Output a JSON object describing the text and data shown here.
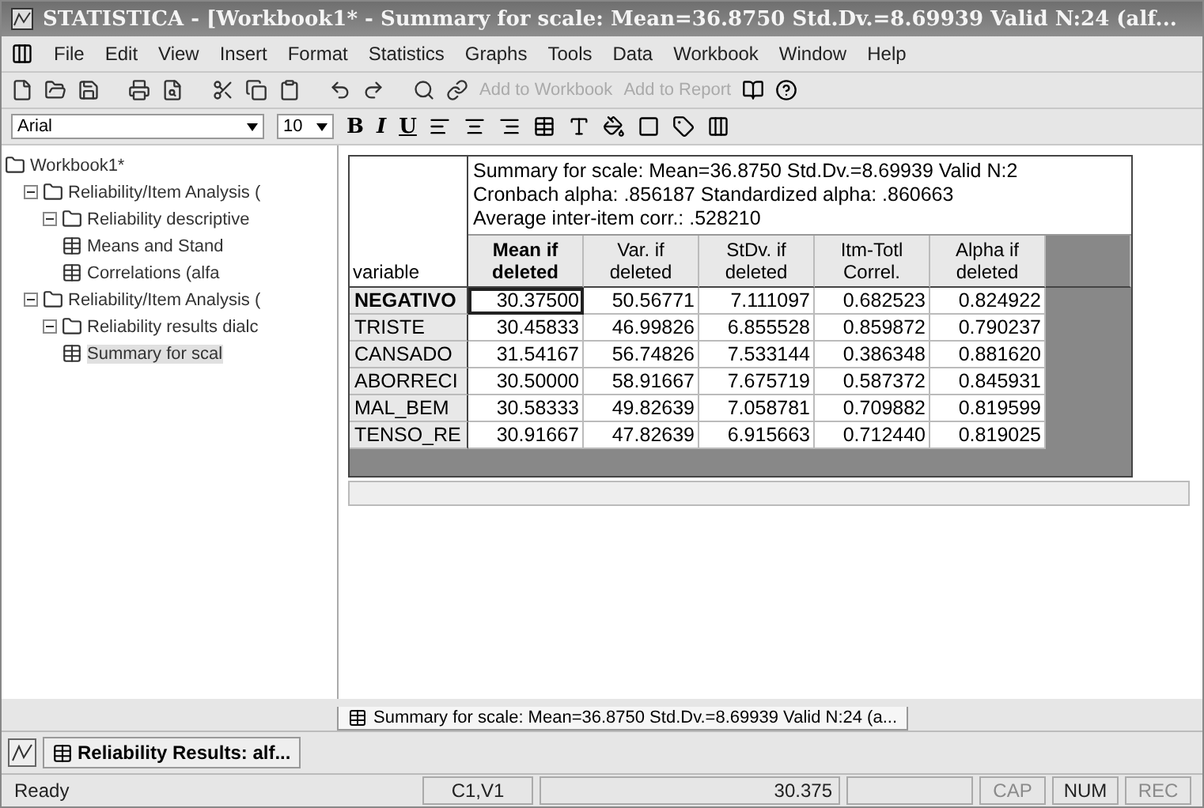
{
  "window": {
    "title": "STATISTICA - [Workbook1* - Summary for scale: Mean=36.8750 Std.Dv.=8.69939 Valid N:24 (alf..."
  },
  "menu": [
    "File",
    "Edit",
    "View",
    "Insert",
    "Format",
    "Statistics",
    "Graphs",
    "Tools",
    "Data",
    "Workbook",
    "Window",
    "Help"
  ],
  "toolbar": {
    "dropdowns": [
      {
        "label": "Add to Workbook",
        "disabled": true
      },
      {
        "label": "Add to Report",
        "disabled": true
      }
    ]
  },
  "format_bar": {
    "font": "Arial",
    "size": "10",
    "style_buttons": [
      "B",
      "I",
      "U"
    ]
  },
  "tree": {
    "label": "Workbook1*",
    "children": [
      {
        "label": "Reliability/Item Analysis (",
        "expanded": true,
        "children": [
          {
            "label": "Reliability descriptive",
            "expanded": true,
            "children": [
              {
                "label": "Means and Stand",
                "selected": false
              },
              {
                "label": "Correlations (alfa",
                "selected": false
              }
            ]
          }
        ]
      },
      {
        "label": "Reliability/Item Analysis (",
        "expanded": true,
        "children": [
          {
            "label": "Reliability results dialc",
            "expanded": true,
            "children": [
              {
                "label": "Summary for scal",
                "selected": true
              }
            ]
          }
        ]
      }
    ]
  },
  "sheet": {
    "corner": "variable",
    "info": [
      "Summary for scale: Mean=36.8750 Std.Dv.=8.69939 Valid N:2",
      "Cronbach alpha: .856187 Standardized alpha: .860663",
      "Average inter-item corr.: .528210"
    ],
    "columns": [
      {
        "label": "Mean if deleted",
        "selected": true
      },
      {
        "label": "Var. if deleted",
        "selected": false
      },
      {
        "label": "StDv. if deleted",
        "selected": false
      },
      {
        "label": "Itm-Totl Correl.",
        "selected": false
      },
      {
        "label": "Alpha if deleted",
        "selected": false
      }
    ],
    "rows": [
      {
        "name": "NEGATIVO",
        "selected": true,
        "values": [
          "30.37500",
          "50.56771",
          "7.111097",
          "0.682523",
          "0.824922"
        ]
      },
      {
        "name": "TRISTE",
        "selected": false,
        "values": [
          "30.45833",
          "46.99826",
          "6.855528",
          "0.859872",
          "0.790237"
        ]
      },
      {
        "name": "CANSADO",
        "selected": false,
        "values": [
          "31.54167",
          "56.74826",
          "7.533144",
          "0.386348",
          "0.881620"
        ]
      },
      {
        "name": "ABORRECI",
        "selected": false,
        "values": [
          "30.50000",
          "58.91667",
          "7.675719",
          "0.587372",
          "0.845931"
        ]
      },
      {
        "name": "MAL_BEM",
        "selected": false,
        "values": [
          "30.58333",
          "49.82639",
          "7.058781",
          "0.709882",
          "0.819599"
        ]
      },
      {
        "name": "TENSO_RE",
        "selected": false,
        "values": [
          "30.91667",
          "47.82639",
          "6.915663",
          "0.712440",
          "0.819025"
        ]
      }
    ]
  },
  "sheet_tab": "Summary for scale: Mean=36.8750 Std.Dv.=8.69939 Valid N:24 (a...",
  "taskbar": {
    "item": "Reliability Results: alf..."
  },
  "status_bar": {
    "message": "Ready",
    "cell": "C1,V1",
    "value": "30.375",
    "indicators": [
      {
        "label": "CAP",
        "on": false
      },
      {
        "label": "NUM",
        "on": true
      },
      {
        "label": "REC",
        "on": false
      }
    ]
  }
}
